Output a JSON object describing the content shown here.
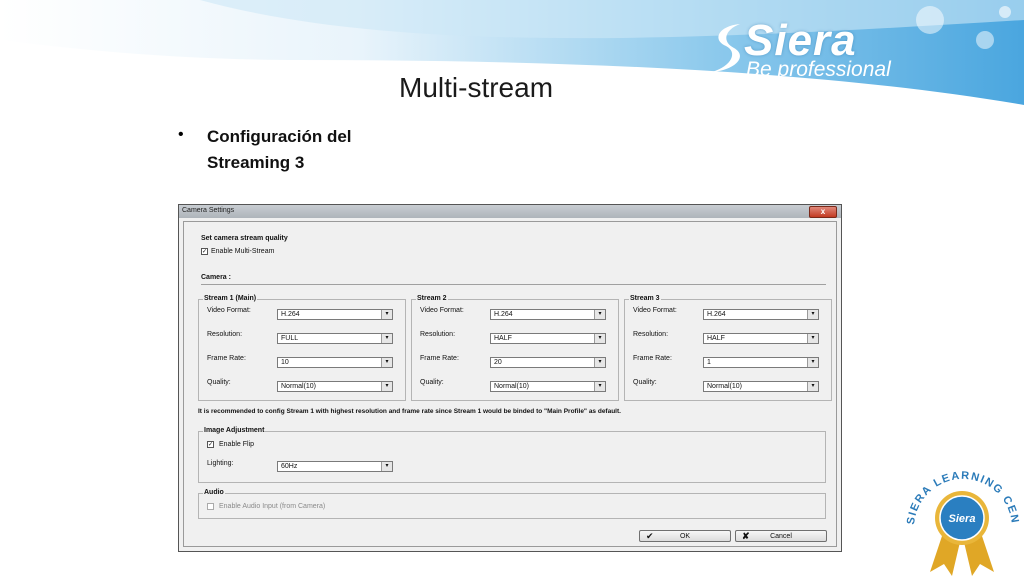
{
  "slide": {
    "title": "Multi-stream",
    "bullet": "Configuración del Streaming 3",
    "logo_word": "Siera",
    "logo_tagline": "Be professional",
    "badge_text": "SIERA LEARNING CENTER",
    "badge_center": "Siera"
  },
  "dialog": {
    "title": "Camera Settings",
    "close": "x",
    "heading": "Set camera stream quality",
    "enable_multistream": "Enable Multi-Stream",
    "camera_label": "Camera :",
    "streams": [
      {
        "title": "Stream 1 (Main)",
        "video_format": "H.264",
        "resolution": "FULL",
        "frame_rate": "10",
        "quality": "Normal(10)"
      },
      {
        "title": "Stream 2",
        "video_format": "H.264",
        "resolution": "HALF",
        "frame_rate": "20",
        "quality": "Normal(10)"
      },
      {
        "title": "Stream 3",
        "video_format": "H.264",
        "resolution": "HALF",
        "frame_rate": "1",
        "quality": "Normal(10)"
      }
    ],
    "labels": {
      "video_format": "Video Format:",
      "resolution": "Resolution:",
      "frame_rate": "Frame Rate:",
      "quality": "Quality:"
    },
    "note": "It is recommended to config Stream 1 with highest resolution and frame rate since Stream 1 would be binded to \"Main Profile\" as default.",
    "image_adjustment": {
      "title": "Image Adjustment",
      "enable_flip": "Enable Flip",
      "lighting_label": "Lighting:",
      "lighting_value": "60Hz"
    },
    "audio": {
      "title": "Audio",
      "enable_audio": "Enable Audio Input (from Camera)"
    },
    "ok": "OK",
    "cancel": "Cancel"
  }
}
